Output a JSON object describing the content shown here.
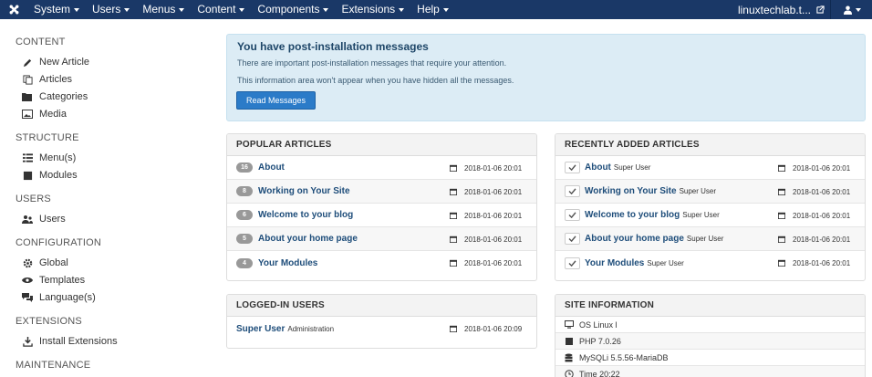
{
  "topbar": {
    "menus": [
      "System",
      "Users",
      "Menus",
      "Content",
      "Components",
      "Extensions",
      "Help"
    ],
    "site_name": "linuxtechlab.t..."
  },
  "sidebar": {
    "content_heading": "CONTENT",
    "content": [
      "New Article",
      "Articles",
      "Categories",
      "Media"
    ],
    "structure_heading": "STRUCTURE",
    "structure": [
      "Menu(s)",
      "Modules"
    ],
    "users_heading": "USERS",
    "users": [
      "Users"
    ],
    "configuration_heading": "CONFIGURATION",
    "configuration": [
      "Global",
      "Templates",
      "Language(s)"
    ],
    "extensions_heading": "EXTENSIONS",
    "extensions": [
      "Install Extensions"
    ],
    "maintenance_heading": "MAINTENANCE"
  },
  "alert": {
    "title": "You have post-installation messages",
    "line1": "There are important post-installation messages that require your attention.",
    "line2": "This information area won't appear when you have hidden all the messages.",
    "button": "Read Messages"
  },
  "popular": {
    "title": "POPULAR ARTICLES",
    "rows": [
      {
        "hits": "16",
        "title": "About",
        "date": "2018-01-06 20:01"
      },
      {
        "hits": "8",
        "title": "Working on Your Site",
        "date": "2018-01-06 20:01"
      },
      {
        "hits": "6",
        "title": "Welcome to your blog",
        "date": "2018-01-06 20:01"
      },
      {
        "hits": "5",
        "title": "About your home page",
        "date": "2018-01-06 20:01"
      },
      {
        "hits": "4",
        "title": "Your Modules",
        "date": "2018-01-06 20:01"
      }
    ]
  },
  "recent": {
    "title": "RECENTLY ADDED ARTICLES",
    "rows": [
      {
        "title": "About",
        "author": "Super User",
        "date": "2018-01-06 20:01"
      },
      {
        "title": "Working on Your Site",
        "author": "Super User",
        "date": "2018-01-06 20:01"
      },
      {
        "title": "Welcome to your blog",
        "author": "Super User",
        "date": "2018-01-06 20:01"
      },
      {
        "title": "About your home page",
        "author": "Super User",
        "date": "2018-01-06 20:01"
      },
      {
        "title": "Your Modules",
        "author": "Super User",
        "date": "2018-01-06 20:01"
      }
    ]
  },
  "logged": {
    "title": "LOGGED-IN USERS",
    "rows": [
      {
        "name": "Super User",
        "area": "Administration",
        "date": "2018-01-06 20:09"
      }
    ]
  },
  "siteinfo": {
    "title": "SITE INFORMATION",
    "rows": [
      {
        "icon": "monitor-icon",
        "text": "OS Linux l"
      },
      {
        "icon": "php-icon",
        "text": "PHP 7.0.26"
      },
      {
        "icon": "database-icon",
        "text": "MySQLi 5.5.56-MariaDB"
      },
      {
        "icon": "clock-icon",
        "text": "Time 20:22"
      }
    ]
  },
  "colors": {
    "navbar": "#1a3867",
    "alert_bg": "#dcecf5",
    "primary_button": "#2b7bc8",
    "link": "#1e4d7a"
  }
}
